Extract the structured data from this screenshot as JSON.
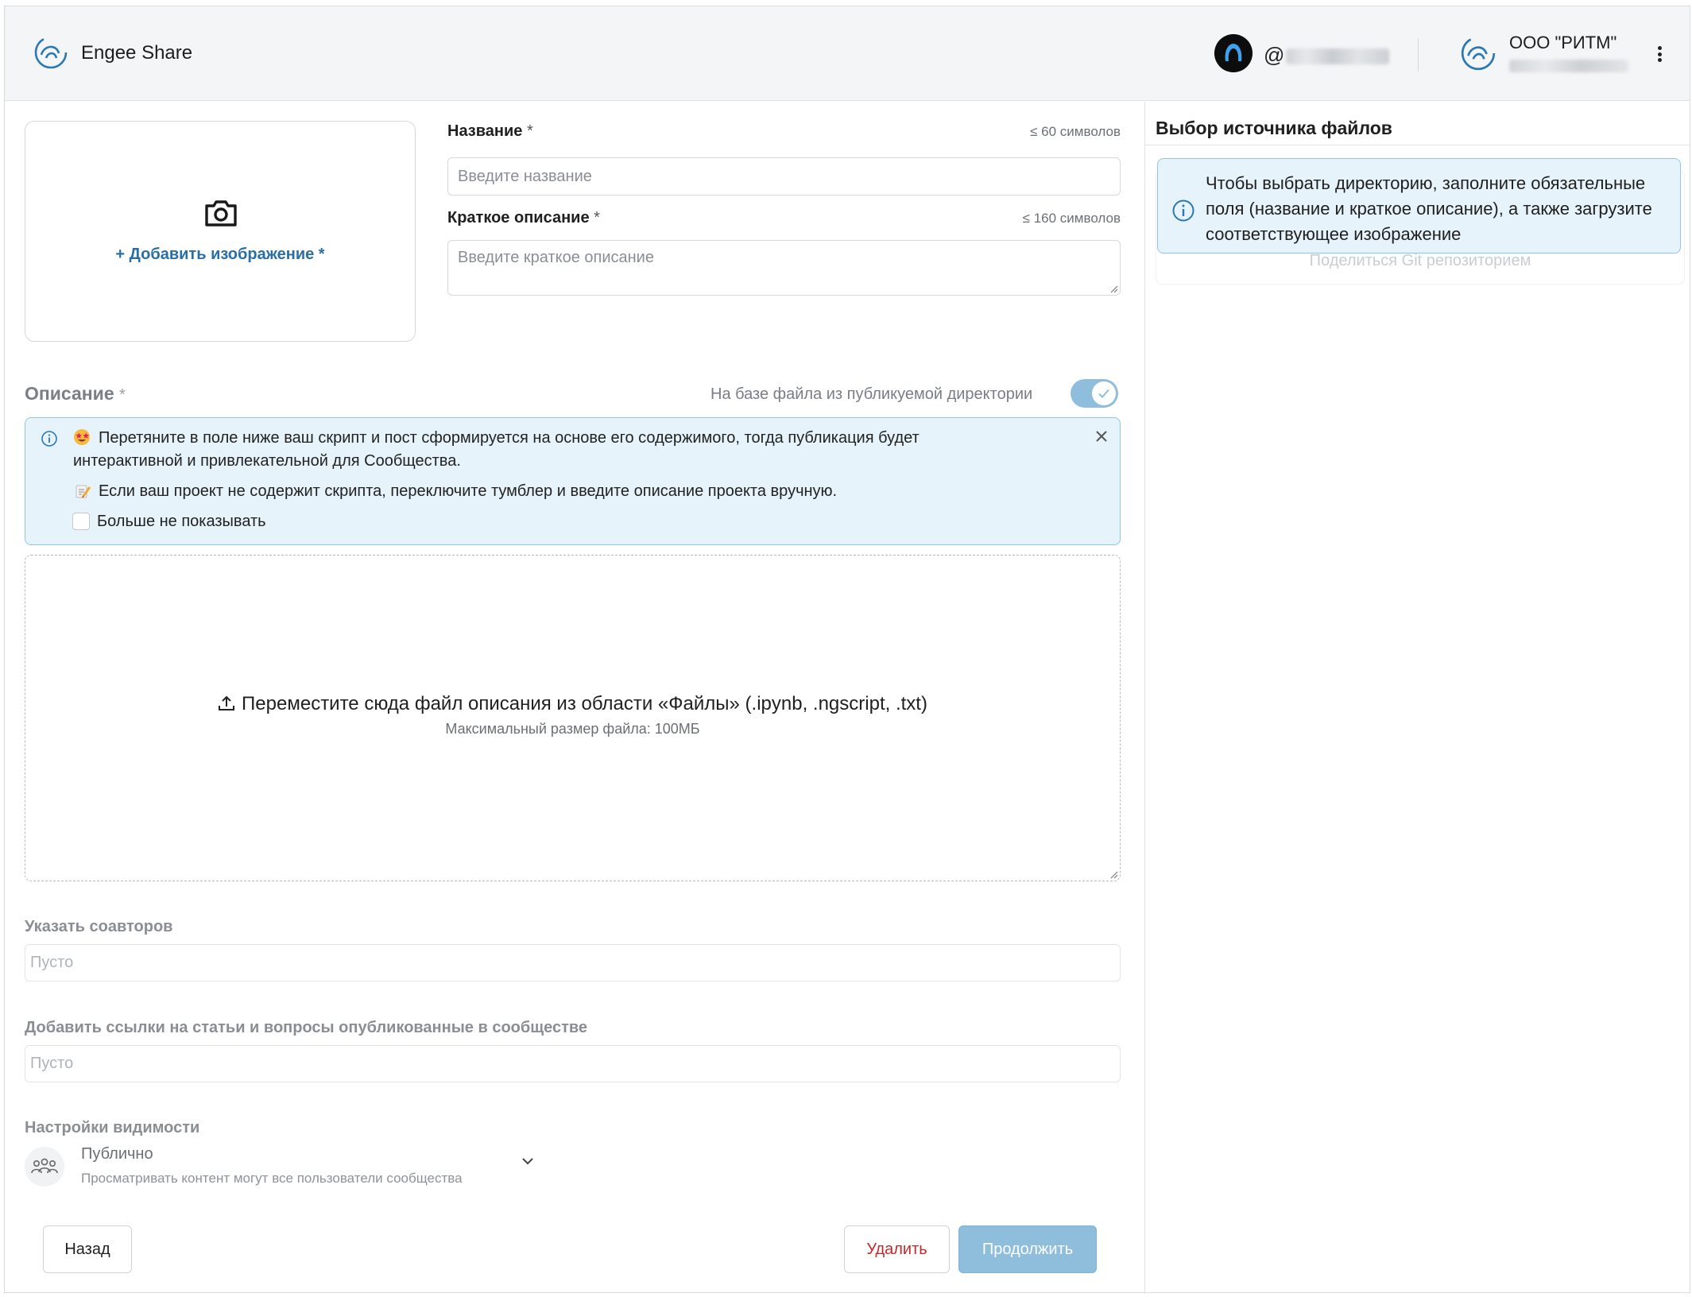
{
  "header": {
    "app_title": "Engee Share",
    "user_handle_prefix": "@",
    "org_name": "ООО \"РИТМ\"",
    "icons": [
      "engee-logo-icon",
      "user-avatar",
      "org-logo-icon",
      "kebab-menu-icon"
    ]
  },
  "image_upload": {
    "label": "+ Добавить изображение *"
  },
  "name_field": {
    "label": "Название",
    "required_mark": "*",
    "hint": "≤ 60 символов",
    "placeholder": "Введите название"
  },
  "short_desc_field": {
    "label": "Краткое описание",
    "required_mark": "*",
    "hint": "≤ 160 символов",
    "placeholder": "Введите краткое описание"
  },
  "description": {
    "title": "Описание",
    "required_mark": "*",
    "toggle_label": "На базе файла из публикуемой директории",
    "toggle_on": true
  },
  "info_banner": {
    "line1a": "Перетяните в поле ниже ваш скрипт и пост сформируется на основе его содержимого, тогда публикация будет",
    "line1b": "интерактивной и привлекательной для Сообщества.",
    "line2": "Если ваш проект не содержит скрипта, переключите тумблер и введите описание проекта вручную.",
    "checkbox_label": "Больше не показывать"
  },
  "dropzone": {
    "main_text": "Переместите сюда файл описания из области «Файлы» (.ipynb, .ngscript, .txt)",
    "sub_text": "Максимальный размер файла: 100МБ"
  },
  "coauthors": {
    "label": "Указать соавторов",
    "placeholder": "Пусто"
  },
  "links": {
    "label": "Добавить ссылки на статьи и вопросы опубликованные в сообществе",
    "placeholder": "Пусто"
  },
  "visibility": {
    "label": "Настройки видимости",
    "selected_title": "Публично",
    "selected_desc": "Просматривать контент могут все пользователи сообщества"
  },
  "buttons": {
    "back": "Назад",
    "delete": "Удалить",
    "continue": "Продолжить"
  },
  "right_panel": {
    "title": "Выбор источника файлов",
    "ghost_text": "Поделиться Git репозиторием",
    "info_text": "Чтобы выбрать директорию, заполните обязательные поля (название и краткое описание), а также загрузите соответствующее изображение"
  },
  "colors": {
    "accent": "#2a6ea6",
    "info_bg": "#e6f3fb",
    "info_border": "#8fc7ea",
    "primary_disabled": "#8fbedc",
    "danger": "#c62828"
  }
}
